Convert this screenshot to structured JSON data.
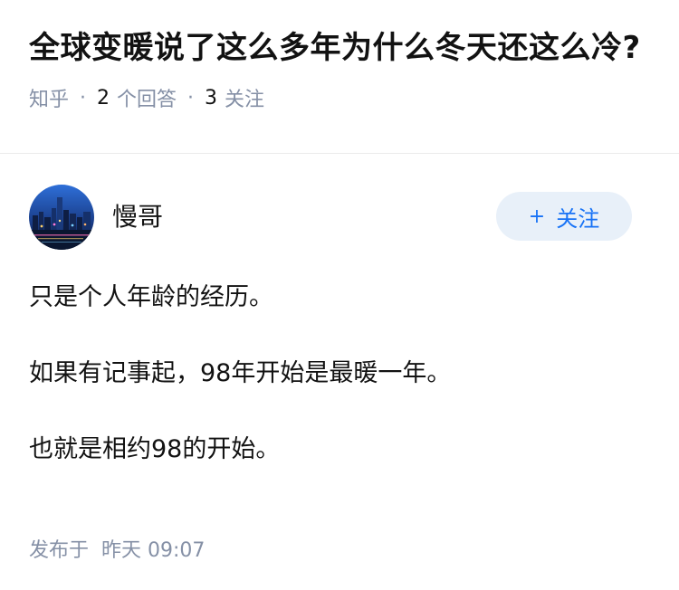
{
  "question": {
    "title": "全球变暖说了这么多年为什么冬天还这么冷?",
    "source": "知乎",
    "answers_count": "2",
    "answers_label": "个回答",
    "followers_count": "3",
    "followers_label": "关注"
  },
  "answer": {
    "author_name": "慢哥",
    "follow_button": {
      "icon": "+",
      "label": "关注"
    },
    "paragraphs": [
      "只是个人年龄的经历。",
      "如果有记事起，98年开始是最暖一年。",
      "也就是相约98的开始。"
    ],
    "publish_label": "发布于",
    "publish_time": "昨天 09:07"
  },
  "colors": {
    "text_primary": "#121212",
    "text_secondary": "#8590a6",
    "accent": "#1772f6",
    "follow_bg": "#e8f0f9",
    "divider": "#ebebeb"
  }
}
